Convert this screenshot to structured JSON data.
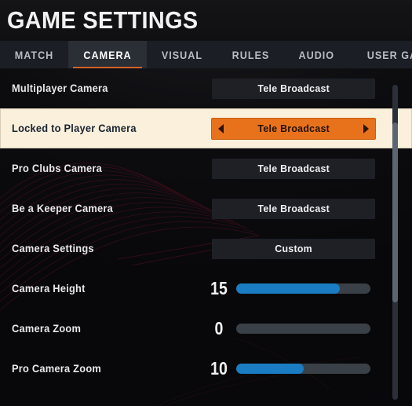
{
  "header": {
    "title": "GAME SETTINGS"
  },
  "tabs": [
    {
      "label": "MATCH",
      "active": false
    },
    {
      "label": "CAMERA",
      "active": true
    },
    {
      "label": "VISUAL",
      "active": false
    },
    {
      "label": "RULES",
      "active": false
    },
    {
      "label": "AUDIO",
      "active": false
    },
    {
      "label": "USER GAMEPLAY",
      "active": false
    }
  ],
  "settings": [
    {
      "label": "Multiplayer Camera",
      "type": "option",
      "value": "Tele Broadcast",
      "selected": false
    },
    {
      "label": "Locked to Player Camera",
      "type": "option",
      "value": "Tele Broadcast",
      "selected": true
    },
    {
      "label": "Pro Clubs Camera",
      "type": "option",
      "value": "Tele Broadcast",
      "selected": false
    },
    {
      "label": "Be a Keeper Camera",
      "type": "option",
      "value": "Tele Broadcast",
      "selected": false
    },
    {
      "label": "Camera Settings",
      "type": "option",
      "value": "Custom",
      "selected": false
    },
    {
      "label": "Camera Height",
      "type": "slider",
      "value": "15",
      "fill_percent": 77,
      "selected": false
    },
    {
      "label": "Camera Zoom",
      "type": "slider",
      "value": "0",
      "fill_percent": 0,
      "selected": false
    },
    {
      "label": "Pro Camera Zoom",
      "type": "slider",
      "value": "10",
      "fill_percent": 50,
      "selected": false
    }
  ],
  "colors": {
    "accent_orange": "#e8721c",
    "tab_underline": "#d4622a",
    "slider_blue": "#1a7dc4",
    "selected_row_bg": "#faf0dc",
    "panel_bg": "#0a0a0c"
  },
  "scrollbar": {
    "thumb_top_percent": 12,
    "thumb_height_percent": 57
  }
}
